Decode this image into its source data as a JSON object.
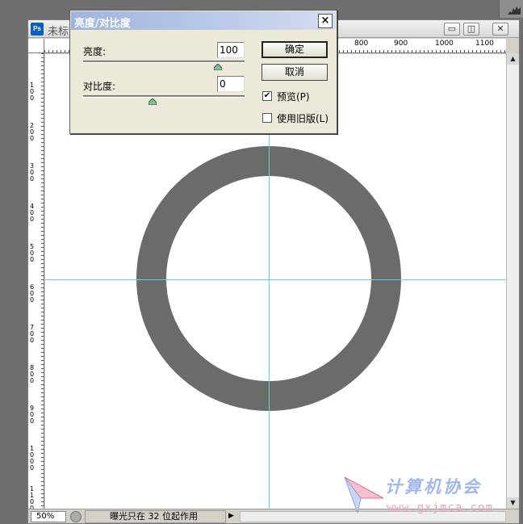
{
  "app": {
    "icon_label": "Ps",
    "document_title": "未标"
  },
  "dialog": {
    "title": "亮度/对比度",
    "close_symbol": "×",
    "brightness": {
      "label": "亮度:",
      "value": "100",
      "level": 1.0
    },
    "contrast": {
      "label": "对比度:",
      "value": "0",
      "level": 0.5
    },
    "buttons": {
      "ok": "确定",
      "cancel": "取消"
    },
    "preview": {
      "label": "预览(P)",
      "checked": true,
      "mark": "✔"
    },
    "legacy": {
      "label": "使用旧版(L)",
      "checked": false
    }
  },
  "window_buttons": {
    "minimize": "▭",
    "restore": "◫",
    "close": "✕"
  },
  "ruler": {
    "top_labels": [
      "800",
      "900",
      "1000",
      "1100"
    ],
    "left_labels": [
      "100",
      "200",
      "300",
      "400",
      "500",
      "600",
      "700",
      "800",
      "900",
      "1000",
      "1100"
    ]
  },
  "status": {
    "zoom": "50%",
    "message": "曝光只在 32 位起作用",
    "arrow": "▶"
  },
  "scroll": {
    "up": "▲",
    "down": "▼"
  },
  "watermark": {
    "title": "计算机协会",
    "url": "www.gxjmca.com"
  },
  "colors": {
    "ring": "#6b6b69",
    "guide": "#5fd6e2",
    "dialog_title": "#9fb3df"
  }
}
